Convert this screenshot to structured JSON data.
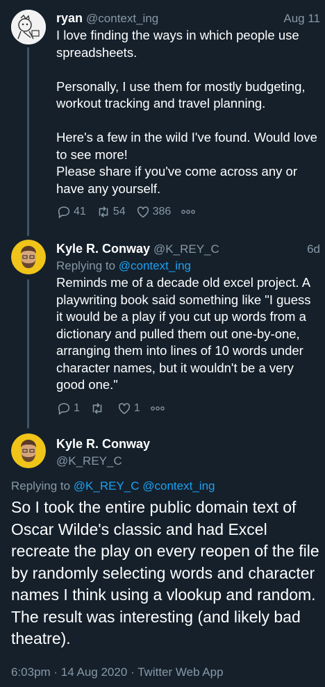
{
  "tweets": [
    {
      "name": "ryan",
      "handle": "@context_ing",
      "time": "Aug 11",
      "text": "I love finding the ways in which people use spreadsheets.\n\nPersonally, I use them for mostly budgeting, workout tracking and travel planning.\n\nHere's a few in the wild I've found. Would love to see more!\nPlease share if you've come across any or have any yourself.",
      "replies": "41",
      "retweets": "54",
      "likes": "386"
    },
    {
      "name": "Kyle R. Conway",
      "handle": "@K_REY_C",
      "time": "6d",
      "replying_prefix": "Replying to ",
      "replying_to": "@context_ing",
      "text": "Reminds me of a decade old excel project. A playwriting book said something like \"I guess it would be a play if you cut up words from a dictionary and pulled them out one-by-one, arranging them into lines of 10 words under character names, but it wouldn't be a very good one.\"",
      "replies": "1",
      "retweets": "",
      "likes": "1"
    }
  ],
  "main": {
    "name": "Kyle R. Conway",
    "handle": "@K_REY_C",
    "replying_prefix": "Replying to ",
    "replying_to_1": "@K_REY_C",
    "replying_to_2": "@context_ing",
    "text": "So I took the entire public domain text of Oscar Wilde's classic and had Excel recreate the play on every reopen of the file by randomly selecting words and character names I think using a vlookup and random. The result was interesting (and likely bad theatre).",
    "meta": "6:03pm · 14 Aug 2020 · Twitter Web App"
  },
  "colors": {
    "background": "#15202b",
    "muted": "#8899a6",
    "link": "#1da1f2",
    "thread_line": "#3d5466"
  }
}
